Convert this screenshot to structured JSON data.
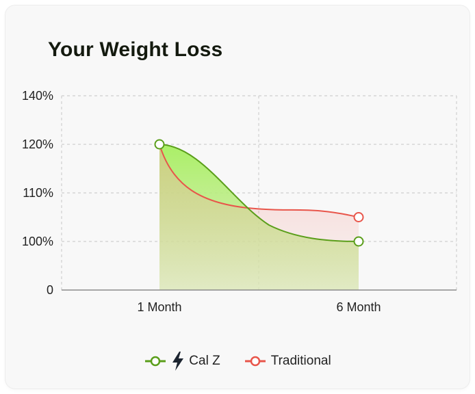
{
  "card": {
    "title": "Your Weight Loss"
  },
  "chart_data": {
    "type": "area",
    "title": "Your Weight Loss",
    "xlabel": "",
    "ylabel": "",
    "categories": [
      "1 Month",
      "6 Month"
    ],
    "y_ticks": [
      {
        "value": 0,
        "label": "0"
      },
      {
        "value": 100,
        "label": "100%"
      },
      {
        "value": 110,
        "label": "110%"
      },
      {
        "value": 120,
        "label": "120%"
      },
      {
        "value": 140,
        "label": "140%"
      }
    ],
    "grid": true,
    "legend_placement": "bottom-center",
    "series": [
      {
        "name": "Cal Z",
        "values": [
          120,
          100
        ],
        "color": "#5a9e1a",
        "fill": "area",
        "icon": "lightning-bolt-icon"
      },
      {
        "name": "Traditional",
        "values": [
          120,
          105
        ],
        "color": "#e8554a",
        "fill": "area"
      }
    ]
  }
}
